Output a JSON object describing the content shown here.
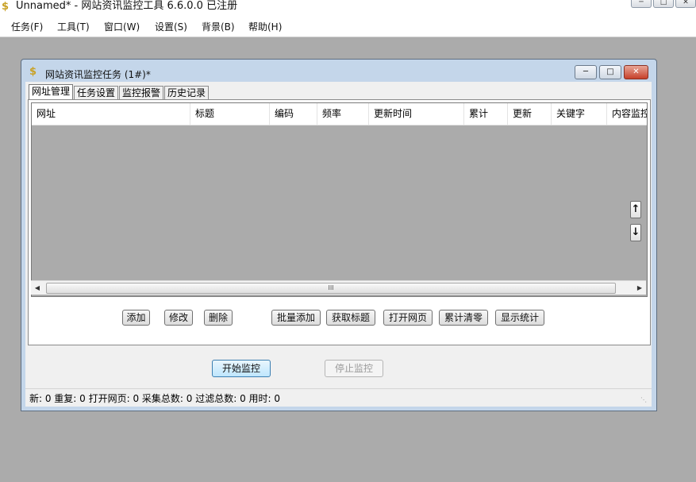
{
  "app": {
    "title": "Unnamed* - 网站资讯监控工具 6.6.0.0  已注册",
    "icon": "dollar-icon"
  },
  "menu": [
    "任务(F)",
    "工具(T)",
    "窗口(W)",
    "设置(S)",
    "背景(B)",
    "帮助(H)"
  ],
  "child_window": {
    "title": "网站资讯监控任务  (1#)*",
    "tabs": [
      "网址管理",
      "任务设置",
      "监控报警",
      "历史记录"
    ],
    "active_tab": "网址管理",
    "columns": [
      "网址",
      "标题",
      "编码",
      "频率",
      "更新时间",
      "累计",
      "更新",
      "关键字",
      "内容监控"
    ],
    "rows": [],
    "hscroll_grip": "III",
    "move_up": "↑",
    "move_down": "↓",
    "actions_left": [
      "添加",
      "修改",
      "删除"
    ],
    "actions_right": [
      "批量添加",
      "获取标题",
      "打开网页",
      "累计清零",
      "显示统计"
    ],
    "start_label": "开始监控",
    "stop_label": "停止监控",
    "status_text": "新:  0   重复:  0   打开网页:  0   采集总数:  0   过滤总数:  0   用时:  0"
  },
  "colors": {
    "workspace": "#ababab",
    "frame": "#c4d6ea",
    "close": "#c6402a"
  }
}
